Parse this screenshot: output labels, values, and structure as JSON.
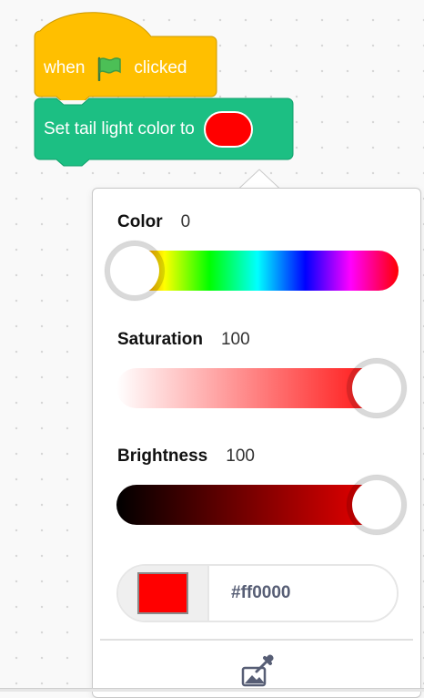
{
  "hat_block": {
    "when_label": "when",
    "flag_icon": "green-flag-icon",
    "clicked_label": "clicked",
    "color": "#ffbf00",
    "border_color": "#cc9900"
  },
  "command_block": {
    "label": "Set tail light color to",
    "color": "#1cbf83",
    "border_color": "#0fa06b",
    "selected_color": "#ff0000"
  },
  "color_picker": {
    "color": {
      "label": "Color",
      "value": "0",
      "fraction": 0.0
    },
    "saturation": {
      "label": "Saturation",
      "value": "100",
      "fraction": 1.0
    },
    "brightness": {
      "label": "Brightness",
      "value": "100",
      "fraction": 1.0
    },
    "hex_value": "#ff0000",
    "eyedropper_icon": "eyedropper-icon"
  }
}
